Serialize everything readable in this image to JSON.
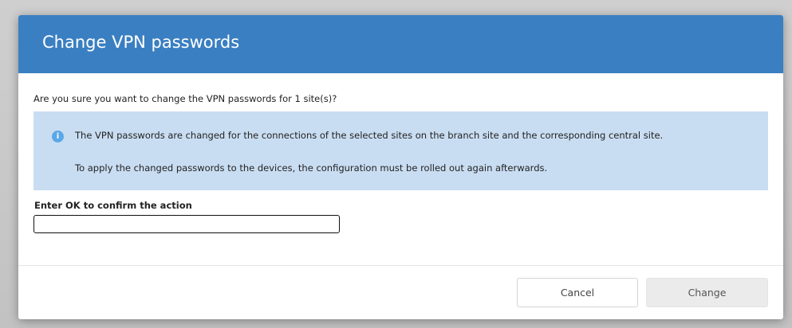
{
  "dialog": {
    "title": "Change VPN passwords",
    "question": "Are you sure you want to change the VPN passwords for 1 site(s)?",
    "info": {
      "icon": "info-icon",
      "line1": "The VPN passwords are changed for the connections of the selected sites on the branch site and the corresponding central site.",
      "line2": "To apply the changed passwords to the devices, the configuration must be rolled out again afterwards."
    },
    "confirm": {
      "label": "Enter OK to confirm the action",
      "value": ""
    },
    "buttons": {
      "cancel": "Cancel",
      "change": "Change"
    }
  },
  "colors": {
    "header": "#3a7fc1",
    "info_bg": "#c9ddf2",
    "info_icon": "#5aa8e6"
  }
}
